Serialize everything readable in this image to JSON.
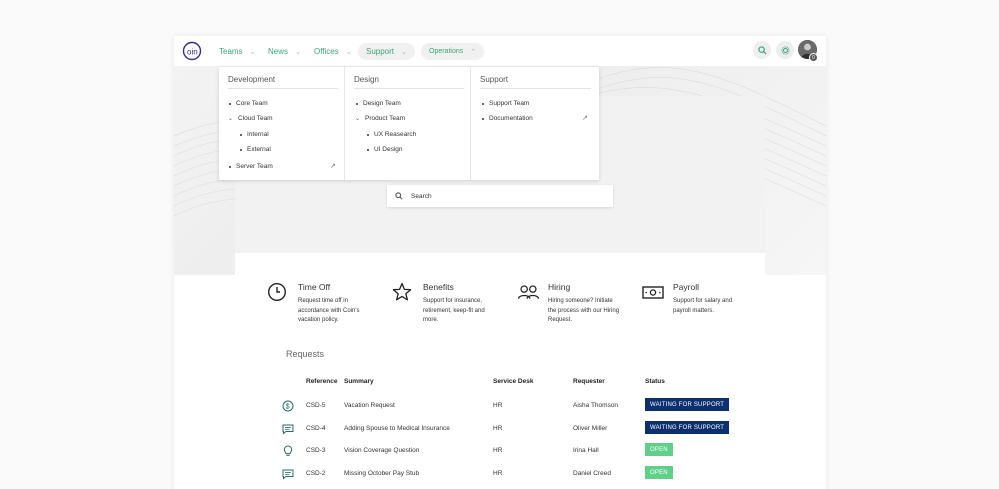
{
  "topbar": {
    "logo_text": "oin",
    "nav": [
      {
        "label": "Teams"
      },
      {
        "label": "News"
      },
      {
        "label": "Offices"
      },
      {
        "label": "Support"
      },
      {
        "label": "Operations"
      }
    ],
    "avatar_badge": "0",
    "accent": "#3aa57a"
  },
  "dropdown": {
    "columns": [
      {
        "heading": "Development",
        "items": [
          "Core Team",
          "Cloud Team",
          "Internal",
          "External",
          "Server Team"
        ]
      },
      {
        "heading": "Design",
        "items": [
          "Design Team",
          "Product Team",
          "UX Reasearch",
          "UI Design"
        ]
      },
      {
        "heading": "Support",
        "items": [
          "Support Team",
          "Documentation"
        ]
      }
    ]
  },
  "search": {
    "placeholder": "Search"
  },
  "services": [
    {
      "title": "Time Off",
      "desc": "Request time off in accordance with Coin's vacation policy.",
      "icon": "clock-icon"
    },
    {
      "title": "Benefits",
      "desc": "Support for insurance, retirement, keep-fit and more.",
      "icon": "star-icon"
    },
    {
      "title": "Hiring",
      "desc": "Hiring someone? Initiate the process with our Hiring Request.",
      "icon": "people-icon"
    },
    {
      "title": "Payroll",
      "desc": "Support for salary and payroll matters.",
      "icon": "money-icon"
    }
  ],
  "requests": {
    "title": "Requests",
    "headers": {
      "reference": "Reference",
      "summary": "Summary",
      "service_desk": "Service Desk",
      "requester": "Requester",
      "status": "Status"
    },
    "rows": [
      {
        "icon": "dollar-icon",
        "reference": "CSD-5",
        "summary": "Vacation Request",
        "service_desk": "HR",
        "requester": "Aisha Thomson",
        "status": "WAITING FOR SUPPORT",
        "status_color": "#0c2f6e"
      },
      {
        "icon": "chat-icon",
        "reference": "CSD-4",
        "summary": "Adding Spouse to Medical Insurance",
        "service_desk": "HR",
        "requester": "Oliver Miller",
        "status": "WAITING FOR SUPPORT",
        "status_color": "#0c2f6e"
      },
      {
        "icon": "lightbulb-icon",
        "reference": "CSD-3",
        "summary": "Vision Coverage Question",
        "service_desk": "HR",
        "requester": "Irina Hall",
        "status": "OPEN",
        "status_color": "#5fcf8a"
      },
      {
        "icon": "chat-icon",
        "reference": "CSD-2",
        "summary": "Missing October Pay Stub",
        "service_desk": "HR",
        "requester": "Daniel Creed",
        "status": "OPEN",
        "status_color": "#5fcf8a"
      }
    ]
  }
}
